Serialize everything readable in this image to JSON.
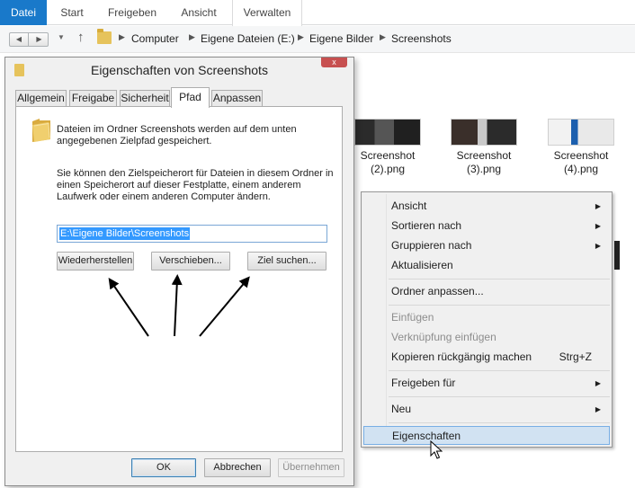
{
  "ribbon": {
    "tabs": [
      "Datei",
      "Start",
      "Freigeben",
      "Ansicht",
      "Verwalten"
    ]
  },
  "address": {
    "crumbs": [
      "Computer",
      "Eigene Dateien (E:)",
      "Eigene Bilder",
      "Screenshots"
    ]
  },
  "files": [
    {
      "line1": "Screenshot",
      "line2": "(2).png"
    },
    {
      "line1": "Screenshot",
      "line2": "(3).png"
    },
    {
      "line1": "Screenshot",
      "line2": "(4).png"
    }
  ],
  "context_menu": {
    "items": [
      {
        "label": "Ansicht",
        "submenu": true
      },
      {
        "label": "Sortieren nach",
        "submenu": true
      },
      {
        "label": "Gruppieren nach",
        "submenu": true
      },
      {
        "label": "Aktualisieren"
      },
      {
        "label": "Ordner anpassen..."
      },
      {
        "label": "Einfügen",
        "disabled": true
      },
      {
        "label": "Verknüpfung einfügen",
        "disabled": true
      },
      {
        "label": "Kopieren rückgängig machen",
        "shortcut": "Strg+Z"
      },
      {
        "label": "Freigeben für",
        "submenu": true
      },
      {
        "label": "Neu",
        "submenu": true
      },
      {
        "label": "Eigenschaften",
        "highlighted": true
      }
    ]
  },
  "dialog": {
    "title": "Eigenschaften von Screenshots",
    "tabs": [
      "Allgemein",
      "Freigabe",
      "Sicherheit",
      "Pfad",
      "Anpassen"
    ],
    "active_tab": "Pfad",
    "description": "Dateien im Ordner Screenshots werden auf dem unten angegebenen Zielpfad gespeichert.",
    "instructions": "Sie können den Zielspeicherort für Dateien in diesem Ordner in einen Speicherort auf dieser Festplatte, einem anderem Laufwerk oder einem anderen Computer ändern.",
    "path_value": "E:\\Eigene Bilder\\Screenshots",
    "buttons": {
      "restore": "Wiederherstellen",
      "move": "Verschieben...",
      "find_target": "Ziel suchen..."
    },
    "footer": {
      "ok": "OK",
      "cancel": "Abbrechen",
      "apply": "Übernehmen"
    },
    "close_glyph": "x"
  },
  "colors": {
    "file_tab": "#1979ca",
    "highlight": "#d1e2f2",
    "selection": "#3399ff"
  }
}
